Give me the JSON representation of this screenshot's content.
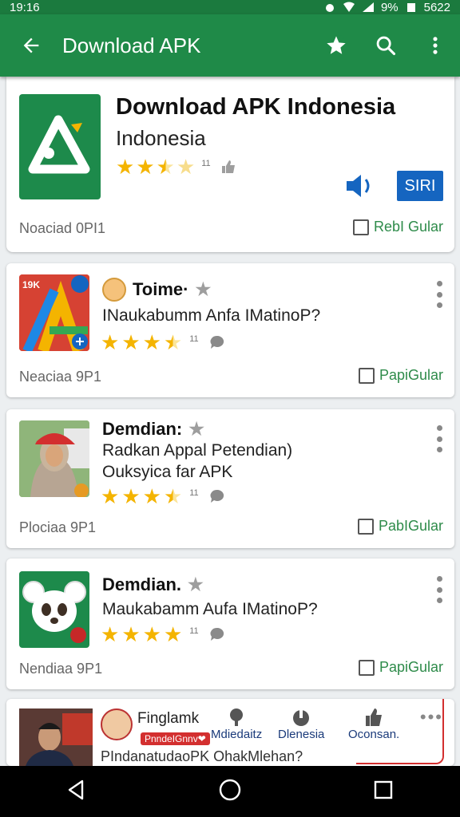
{
  "status": {
    "time": "19:16",
    "battery": "9%",
    "right_text": "5622"
  },
  "appbar": {
    "title": "Download APK",
    "back_icon": "arrow-back-icon",
    "actions": [
      "star-add-icon",
      "search-icon",
      "more-vert-icon"
    ]
  },
  "colors": {
    "appbar": "#1f8a48",
    "statusbar": "#1b7a3e",
    "star": "#f4b400",
    "button": "#1565c0",
    "link_green": "#2e8b4a"
  },
  "featured": {
    "title": "Download APK Indonesia",
    "subtitle": "Indonesia",
    "rating": 2.5,
    "rating_count": "11",
    "button_label": "SIRI",
    "footer_left": "Noaciad 0PI1",
    "footer_right": "RebI Gular"
  },
  "apps": [
    {
      "name": "Toime·",
      "description": "INaukabumm Anfa IMatinoP?",
      "rating": 3.5,
      "rating_count": "11",
      "footer_left": "Neaciaa 9P1",
      "footer_right": "PapiGular",
      "thumb_text": "19K"
    },
    {
      "name": "Demdian:",
      "description": "Radkan Appal Petendian)",
      "description2": "Ouksyica far APK",
      "rating": 3.5,
      "rating_count": "11",
      "footer_left": "Plociaa 9P1",
      "footer_right": "PabIGular"
    },
    {
      "name": "Demdian.",
      "description": "Maukabamm Aufa IMatinoP?",
      "rating": 4,
      "rating_count": "11",
      "footer_left": "Nendiaa 9P1",
      "footer_right": "PapiGular"
    }
  ],
  "partial_card": {
    "name": "Finglamk",
    "tag": "PnndeIGnnv❤",
    "actions": [
      "Mdiedaitz",
      "Dlenesia",
      "Oconsan."
    ],
    "bottom_text": "PIndanatudaoPK OhakMlehan?",
    "more": "•••"
  },
  "navbar": [
    "back-triangle-icon",
    "home-circle-icon",
    "recents-square-icon"
  ]
}
